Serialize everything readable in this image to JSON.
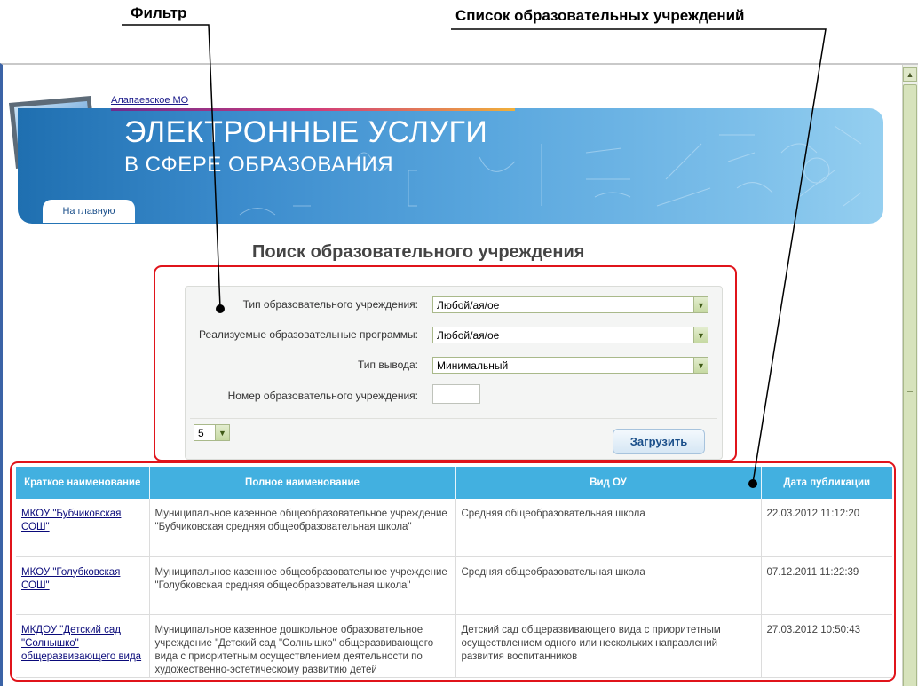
{
  "annotations": {
    "filter_label": "Фильтр",
    "list_label": "Список образовательных учреждений"
  },
  "header": {
    "region_link": "Алапаевское МО",
    "title": "ЭЛЕКТРОННЫЕ УСЛУГИ",
    "subtitle": "В СФЕРЕ ОБРАЗОВАНИЯ",
    "home_tab": "На главную"
  },
  "search": {
    "heading": "Поиск образовательного учреждения",
    "fields": [
      {
        "label": "Тип образовательного учреждения:",
        "value": "Любой/ая/ое"
      },
      {
        "label": "Реализуемые образовательные программы:",
        "value": "Любой/ая/ое"
      },
      {
        "label": "Тип вывода:",
        "value": "Минимальный"
      },
      {
        "label": "Номер образовательного учреждения:",
        "value": ""
      }
    ],
    "page_size": "5",
    "load_button": "Загрузить"
  },
  "table": {
    "columns": [
      "Краткое наименование",
      "Полное наименование",
      "Вид ОУ",
      "Дата публикации"
    ],
    "rows": [
      {
        "short": "МКОУ \"Бубчиковская СОШ\"",
        "full": "Муниципальное казенное общеобразовательное учреждение \"Бубчиковская средняя общеобразовательная школа\"",
        "kind": "Средняя общеобразовательная школа",
        "date": "22.03.2012 11:12:20"
      },
      {
        "short": "МКОУ \"Голубковская СОШ\"",
        "full": "Муниципальное казенное общеобразовательное учреждение \"Голубковская средняя общеобразовательная школа\"",
        "kind": "Средняя общеобразовательная школа",
        "date": "07.12.2011 11:22:39"
      },
      {
        "short": "МКДОУ \"Детский сад \"Солнышко\" общеразвивающего вида",
        "full": "Муниципальное казенное дошкольное образовательное учреждение \"Детский сад \"Солнышко\" общеразвивающего вида с приоритетным осуществлением деятельности по художественно-эстетическому развитию детей",
        "kind": "Детский сад общеразвивающего вида с приоритетным осуществлением одного или нескольких направлений развития воспитанников",
        "date": "27.03.2012 10:50:43"
      }
    ]
  },
  "colors": {
    "highlight": "#e0141b",
    "table_header": "#42b0e0",
    "banner": "#3b8bcc"
  }
}
